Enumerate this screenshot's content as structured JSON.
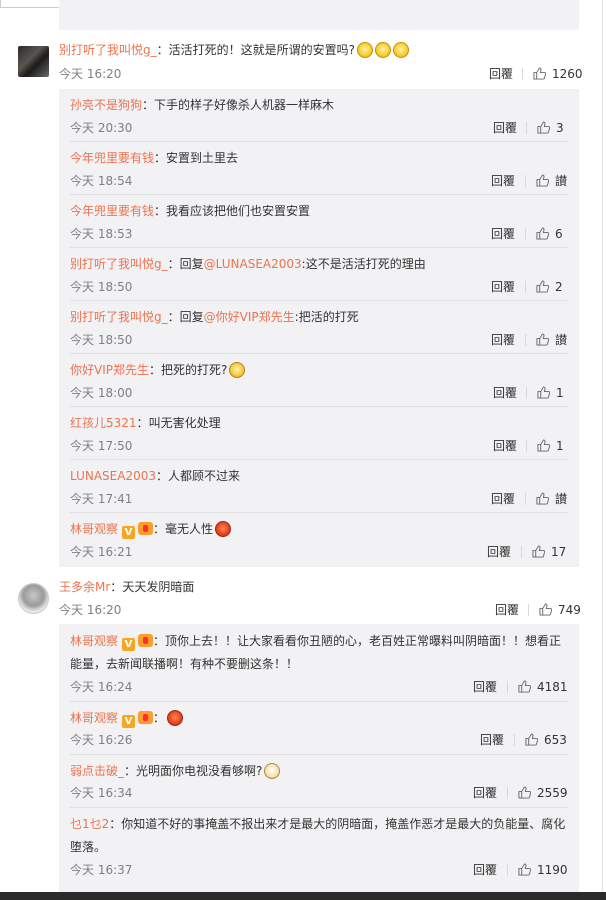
{
  "comments": [
    {
      "user": "别打听了我叫悦g_",
      "text": "活活打死的！这就是所谓的安置吗?",
      "time": "今天 16:20",
      "reply_label": "回覆",
      "likes": "1260",
      "replies": [
        {
          "user": "孙亮不是狗狗",
          "text": "下手的样子好像杀人机器一样麻木",
          "time": "今天 20:30",
          "reply_label": "回覆",
          "likes": "3"
        },
        {
          "user": "今年兜里要有钱",
          "text": "安置到土里去",
          "time": "今天 18:54",
          "reply_label": "回覆",
          "likes": "讃"
        },
        {
          "user": "今年兜里要有钱",
          "text": "我看应该把他们也安置安置",
          "time": "今天 18:53",
          "reply_label": "回覆",
          "likes": "6"
        },
        {
          "user": "别打听了我叫悦g_",
          "pre": "回复",
          "at": "@LUNASEA2003",
          "text": ":这不是活活打死的理由",
          "time": "今天 18:50",
          "reply_label": "回覆",
          "likes": "2"
        },
        {
          "user": "别打听了我叫悦g_",
          "pre": "回复",
          "at": "@你好VIP郑先生",
          "text": ":把活的打死",
          "time": "今天 18:50",
          "reply_label": "回覆",
          "likes": "讃"
        },
        {
          "user": "你好VIP郑先生",
          "text": "把死的打死?",
          "time": "今天 18:00",
          "reply_label": "回覆",
          "likes": "1"
        },
        {
          "user": "红孩儿5321",
          "text": "叫无害化处理",
          "time": "今天 17:50",
          "reply_label": "回覆",
          "likes": "1"
        },
        {
          "user": "LUNASEA2003",
          "text": "人都顾不过来",
          "time": "今天 17:41",
          "reply_label": "回覆",
          "likes": "讃"
        },
        {
          "user": "林哥观察",
          "text": "毫无人性",
          "time": "今天 16:21",
          "reply_label": "回覆",
          "likes": "17"
        }
      ]
    },
    {
      "user": "王多余Mr",
      "text": "天天发阴暗面",
      "time": "今天 16:20",
      "reply_label": "回覆",
      "likes": "749",
      "replies": [
        {
          "user": "林哥观察",
          "text": "顶你上去！！让大家看看你丑陋的心，老百姓正常曝料叫阴暗面！！想看正",
          "text2": "能量，去新闻联播啊！有种不要删这条！！",
          "time": "今天 16:24",
          "reply_label": "回覆",
          "likes": "4181"
        },
        {
          "user": "林哥观察",
          "text": "",
          "time": "今天 16:26",
          "reply_label": "回覆",
          "likes": "653"
        },
        {
          "user": "弱点击破_",
          "text": "光明面你电视没看够啊?",
          "time": "今天 16:34",
          "reply_label": "回覆",
          "likes": "2559"
        },
        {
          "user": "乜1乜2",
          "text": "你知道不好的事掩盖不报出来才是最大的阴暗面，掩盖作恶才是最大的负能量、腐化",
          "text2": "堕落。",
          "time": "今天 16:37",
          "reply_label": "回覆",
          "likes": "1190"
        }
      ]
    }
  ],
  "colon": "："
}
